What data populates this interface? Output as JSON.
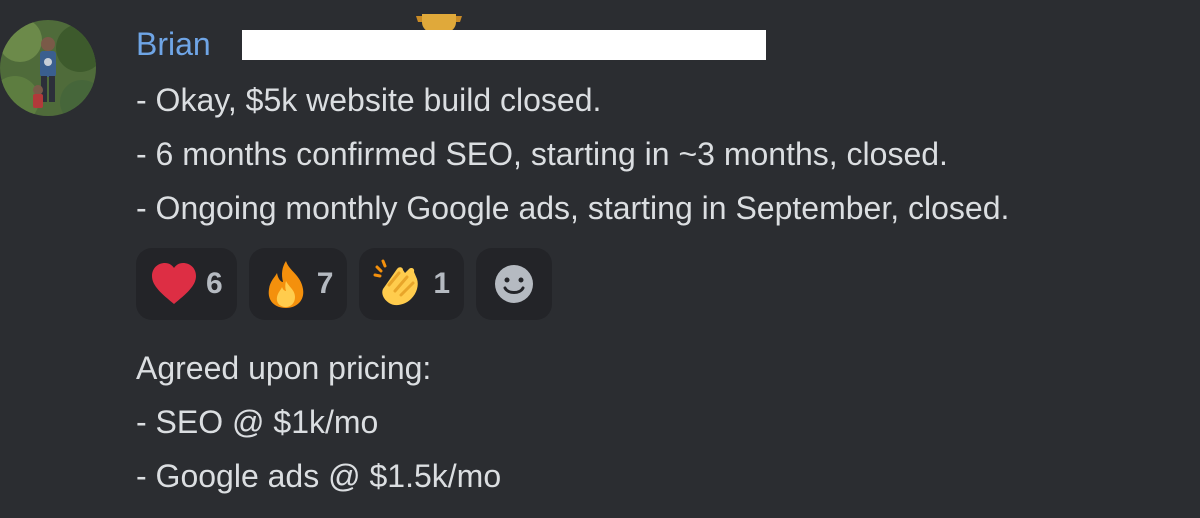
{
  "message": {
    "author": "Brian",
    "lines": [
      "- Okay, $5k website build closed.",
      "- 6 months confirmed SEO, starting in ~3 months, closed.",
      "- Ongoing monthly Google ads, starting in September, closed."
    ],
    "reactions": [
      {
        "icon": "heart-icon",
        "count": "6"
      },
      {
        "icon": "fire-icon",
        "count": "7"
      },
      {
        "icon": "clapping-hands-icon",
        "count": "1"
      }
    ],
    "followup_lines": [
      "Agreed upon pricing:",
      "- SEO @ $1k/mo",
      "- Google ads @ $1.5k/mo"
    ]
  },
  "colors": {
    "background": "#2b2d31",
    "username": "#6fa5e6",
    "text": "#dbdee1",
    "reaction_bg": "#232428"
  }
}
